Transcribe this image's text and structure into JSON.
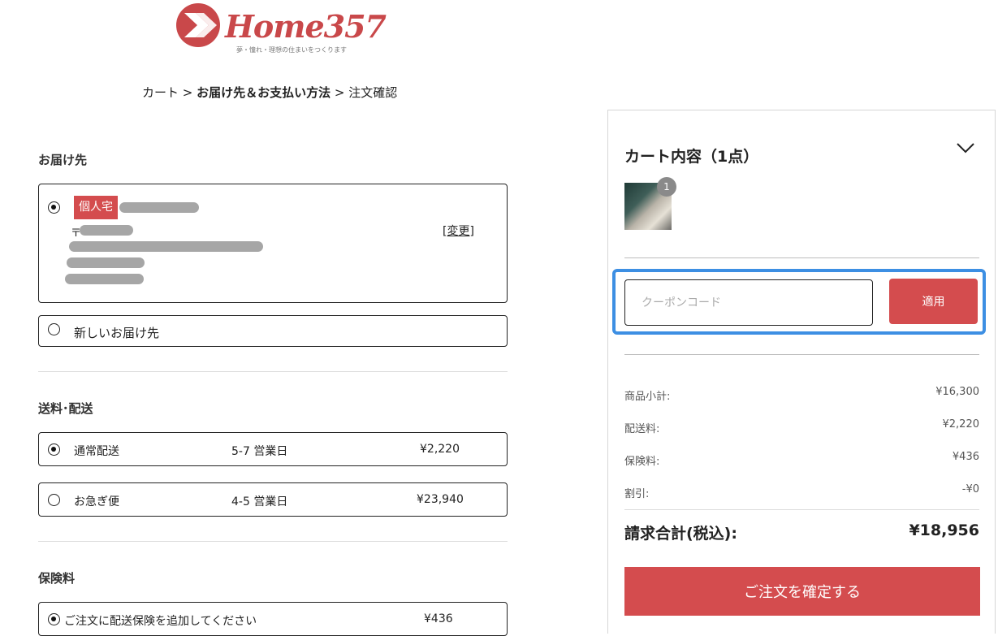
{
  "brand": {
    "name": "Home357",
    "tagline": "夢・憧れ・理想の住まいをつくります",
    "color": "#c9484a"
  },
  "breadcrumb": {
    "cart": "カート",
    "sep": " > ",
    "current": "お届け先＆お支払い方法",
    "confirm": "注文確認"
  },
  "delivery": {
    "title": "お届け先",
    "selected_badge": "個人宅",
    "postal_prefix": "〒",
    "change_link": "[変更]",
    "new_address_label": "新しいお届け先"
  },
  "shipping": {
    "title": "送料･配送",
    "options": [
      {
        "name": "通常配送",
        "days": "5-7 営業日",
        "price": "¥2,220",
        "selected": true
      },
      {
        "name": "お急ぎ便",
        "days": "4-5 営業日",
        "price": "¥23,940",
        "selected": false
      }
    ]
  },
  "insurance": {
    "title": "保険料",
    "option_label": "ご注文に配送保険を追加してください",
    "price": "¥436"
  },
  "cart": {
    "title": "カート内容（1点）",
    "item_count_badge": "1",
    "coupon_placeholder": "クーポンコード",
    "apply_label": "適用",
    "summary": [
      {
        "label": "商品小計:",
        "value": "¥16,300"
      },
      {
        "label": "配送料:",
        "value": "¥2,220"
      },
      {
        "label": "保険料:",
        "value": "¥436"
      },
      {
        "label": "割引:",
        "value": "-¥0"
      }
    ],
    "total_label": "請求合計(税込):",
    "total_value": "¥18,956",
    "confirm_label": "ご注文を確定する"
  },
  "colors": {
    "accent": "#d44c4e",
    "focus": "#3d8fe3"
  }
}
